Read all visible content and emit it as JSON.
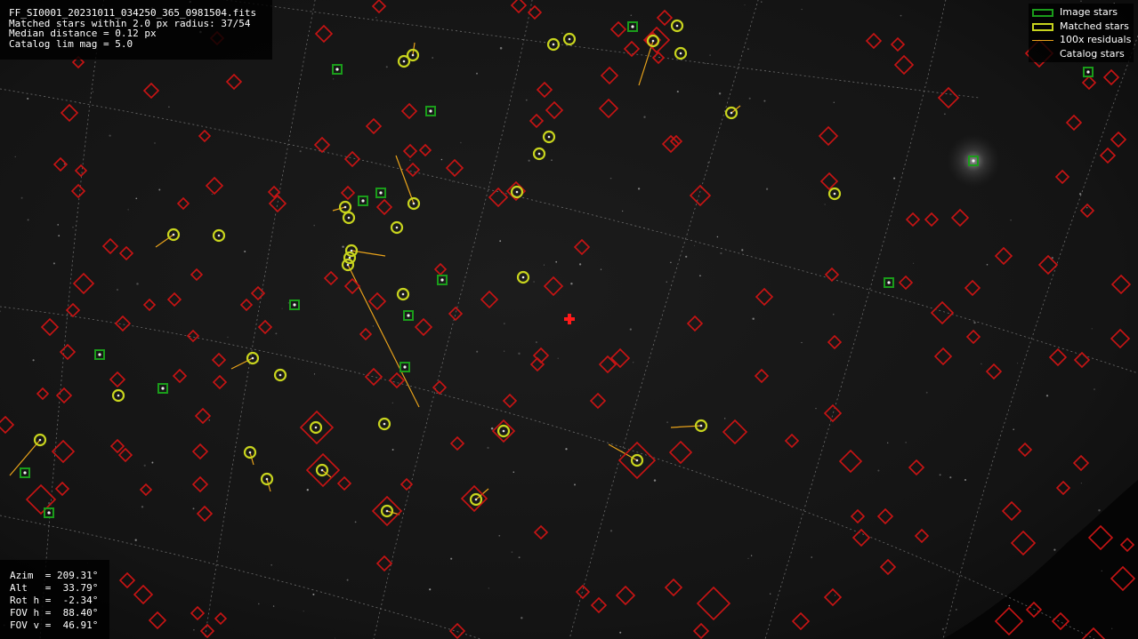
{
  "window_title": "FF_SI0001_20231011_034250_365_0981504.fits",
  "file_info": {
    "filename": "FF_SI0001_20231011_034250_365_0981504.fits",
    "matched_line": "Matched stars within 2.0 px radius: 37/54",
    "median_line": "Median distance = 0.12 px",
    "catalog_line": "Catalog lim mag = 5.0"
  },
  "pointing_info": {
    "azim": "Azim  = 209.31°",
    "alt": "Alt   =  33.79°",
    "rot": "Rot h =  -2.34°",
    "fov_h": "FOV h =  88.40°",
    "fov_v": "FOV v =  46.91°"
  },
  "legend": {
    "image_stars": "Image stars",
    "matched_stars": "Matched stars",
    "residuals": "100x residuals",
    "catalog_stars": "Catalog stars"
  },
  "colors": {
    "image_star": "#1a9c1a",
    "matched_star": "#c8d41e",
    "residual": "#e8a21a",
    "catalog_star": "#c81414",
    "grid": "#8a8a8a",
    "center_mark": "#ff1a1a",
    "background": "#000000"
  },
  "icons": {
    "center_marker": "red-plus-icon"
  }
}
